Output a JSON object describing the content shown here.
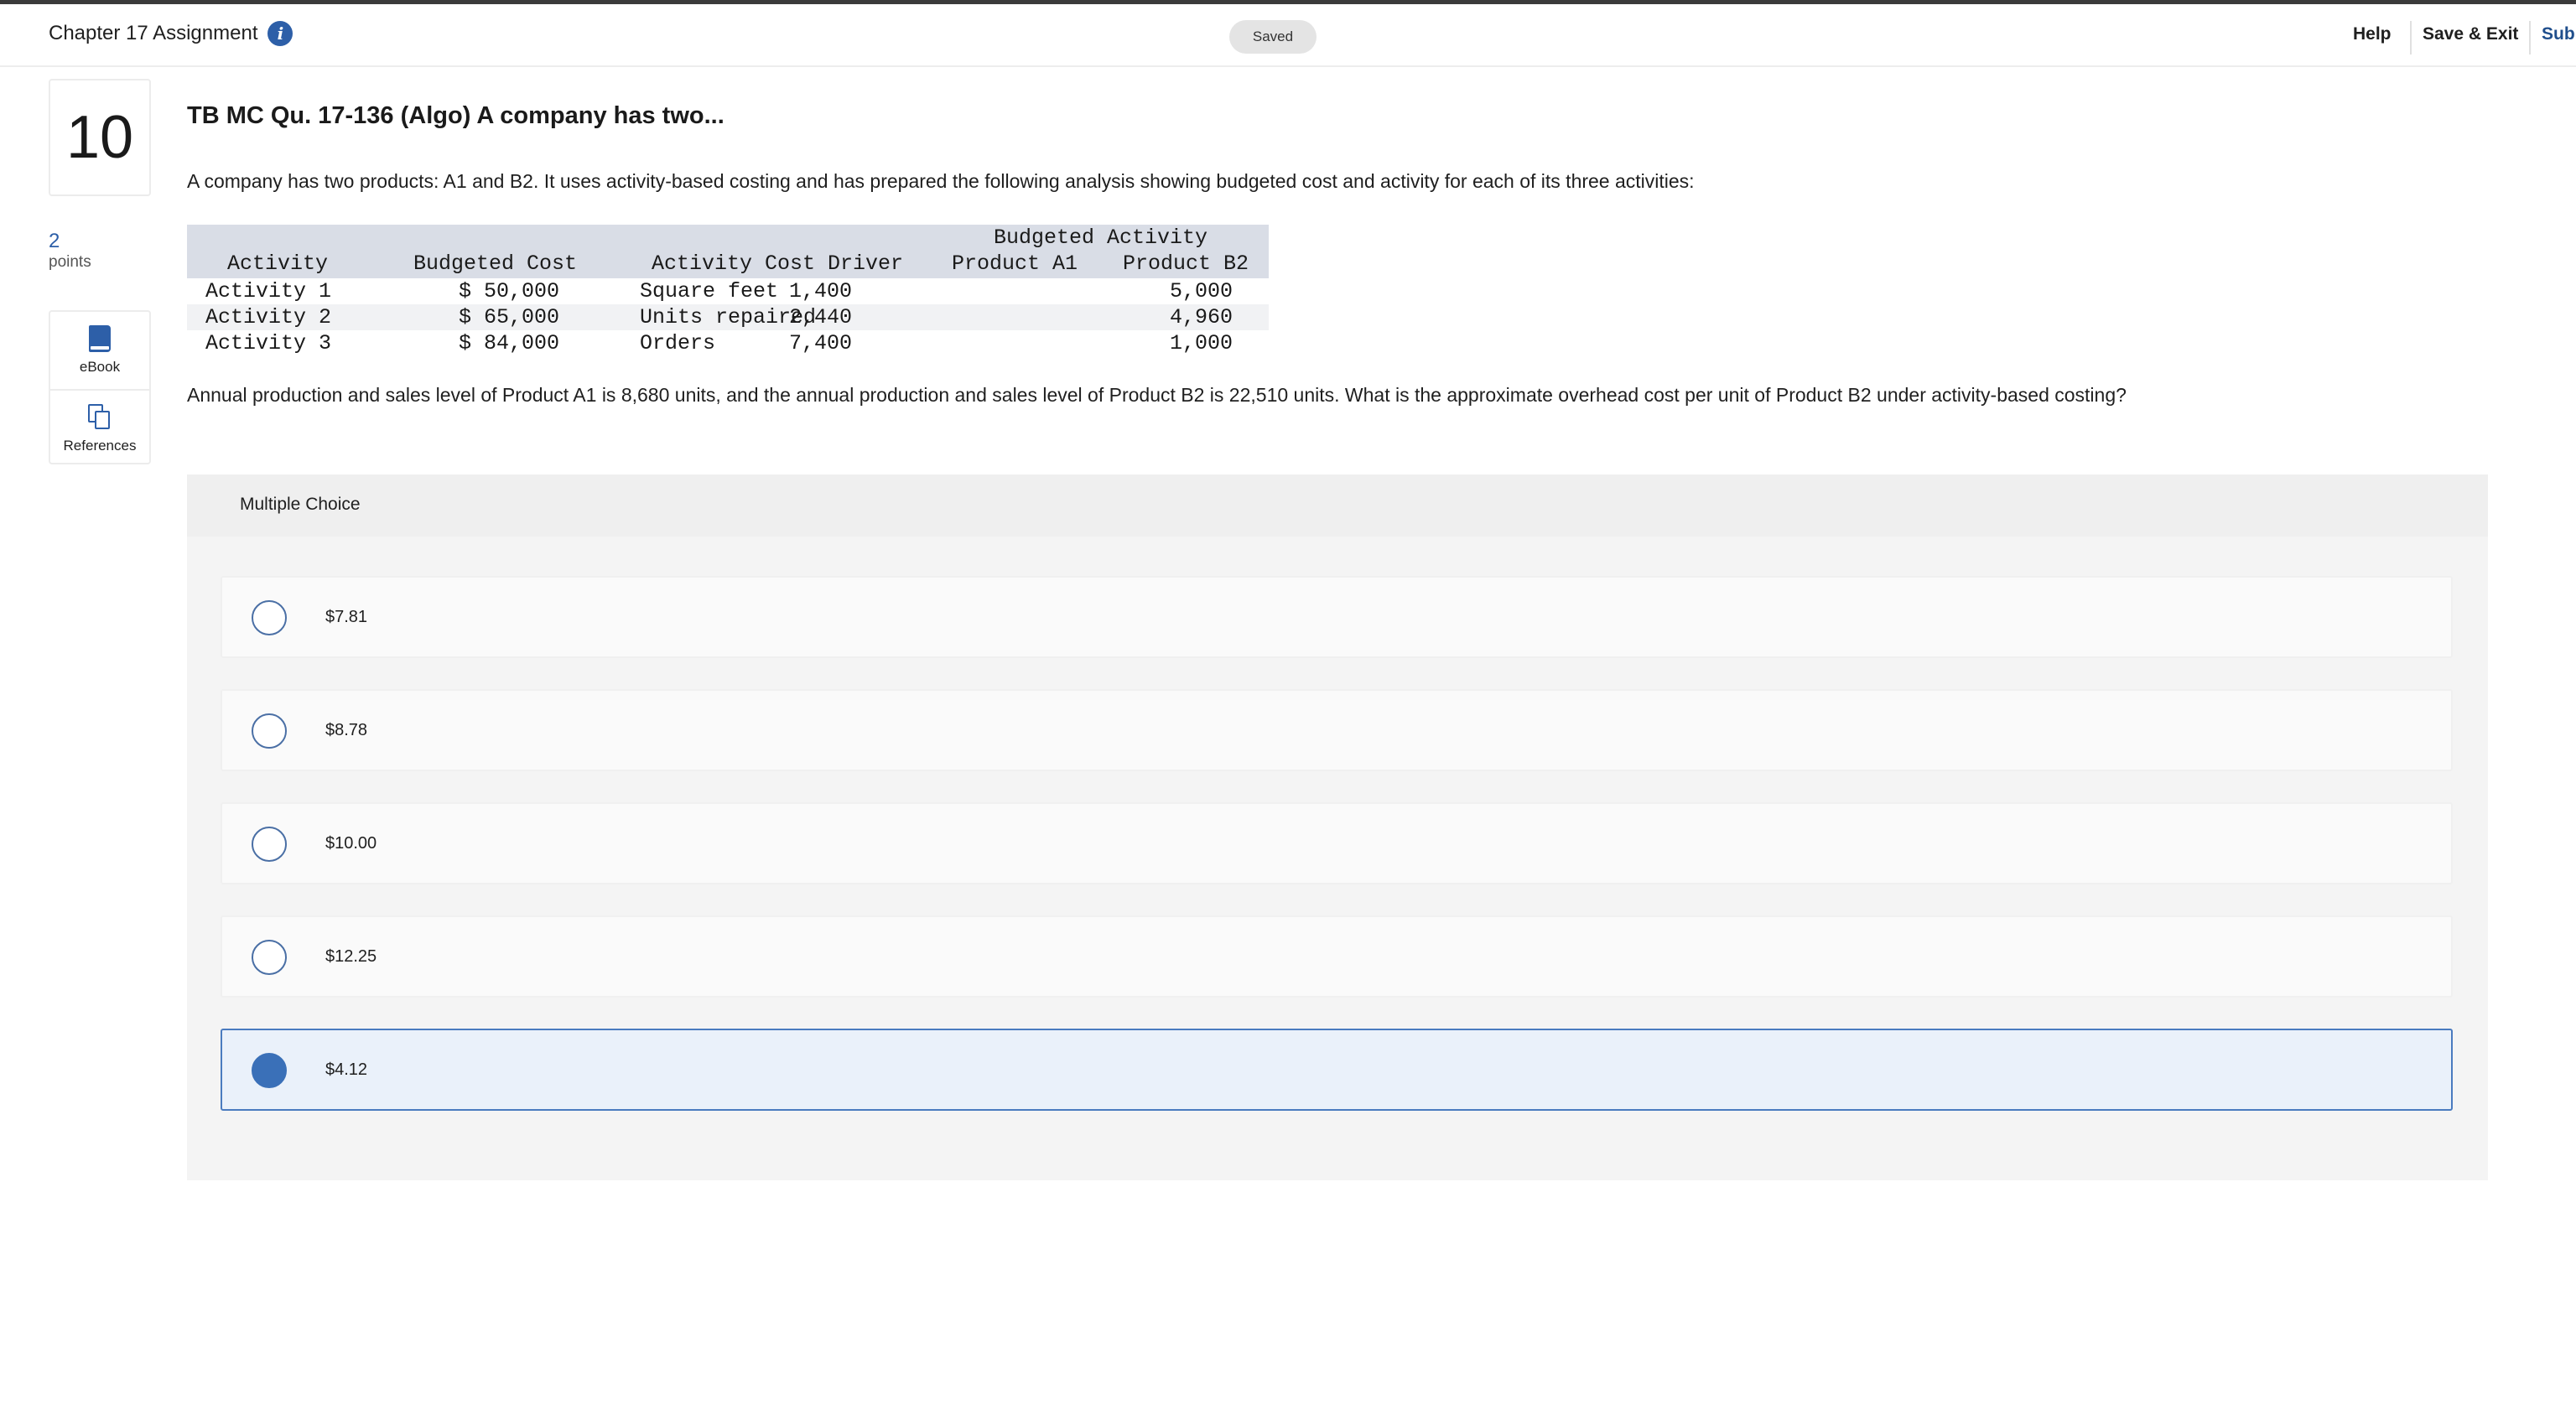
{
  "header": {
    "assignment_title": "Chapter 17 Assignment",
    "info_icon": "info-icon",
    "save_status": "Saved",
    "help_label": "Help",
    "save_exit_label": "Save & Exit",
    "submit_label": "Submit"
  },
  "sidebar": {
    "question_number": "10",
    "points_value": "2",
    "points_label": "points",
    "tools": [
      {
        "label": "eBook",
        "icon": "book-icon"
      },
      {
        "label": "References",
        "icon": "references-icon"
      }
    ]
  },
  "question": {
    "heading": "TB MC Qu. 17-136 (Algo) A company has two...",
    "intro": "A company has two products: A1 and B2. It uses activity-based costing and has prepared the following analysis showing budgeted cost and activity for each of its three activities:",
    "table": {
      "group_header": "Budgeted Activity",
      "columns": [
        "Activity",
        "Budgeted Cost",
        "Activity Cost Driver",
        "Product A1",
        "Product B2"
      ],
      "rows": [
        [
          "Activity 1",
          "$ 50,000",
          "Square feet",
          "1,400",
          "5,000"
        ],
        [
          "Activity 2",
          "$ 65,000",
          "Units repaired",
          "2,440",
          "4,960"
        ],
        [
          "Activity 3",
          "$ 84,000",
          "Orders",
          "7,400",
          "1,000"
        ]
      ]
    },
    "prompt": "Annual production and sales level of Product A1 is 8,680 units, and the annual production and sales level of Product B2 is 22,510 units. What is the approximate overhead cost per unit of Product B2 under activity-based costing?"
  },
  "multiple_choice": {
    "title": "Multiple Choice",
    "options": [
      {
        "label": "$7.81",
        "selected": false
      },
      {
        "label": "$8.78",
        "selected": false
      },
      {
        "label": "$10.00",
        "selected": false
      },
      {
        "label": "$12.25",
        "selected": false
      },
      {
        "label": "$4.12",
        "selected": true
      }
    ]
  },
  "colors": {
    "accent": "#2d5fa8",
    "selected_bg": "#eaf1fa",
    "table_header_bg": "#d9dde6"
  }
}
